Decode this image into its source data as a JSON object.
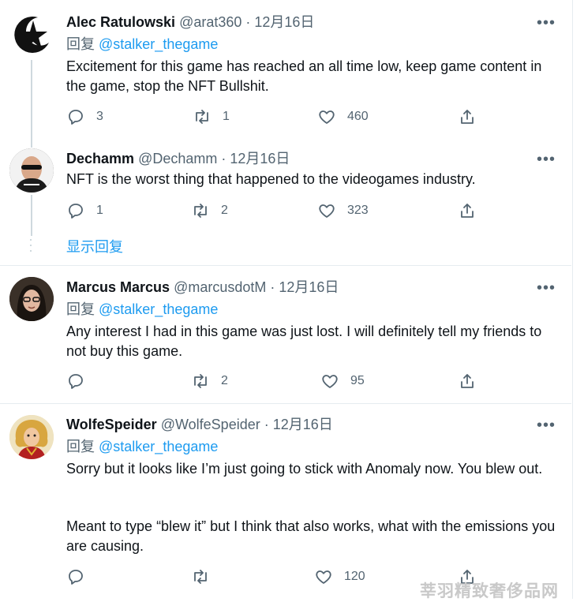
{
  "tweets": [
    {
      "name": "Alec Ratulowski",
      "handle": "@arat360",
      "sep": " · ",
      "date": "12月16日",
      "reply_prefix": "回复 ",
      "reply_to": "@stalker_thegame",
      "text": "Excitement for this game has reached an all time low, keep game content in the game, stop the NFT Bullshit.",
      "replies": "3",
      "retweets": "1",
      "likes": "460"
    },
    {
      "name": "Dechamm",
      "handle": "@Dechamm",
      "sep": " · ",
      "date": "12月16日",
      "text": "NFT is the worst thing that happened to the videogames industry.",
      "replies": "1",
      "retweets": "2",
      "likes": "323"
    },
    {
      "name": "Marcus Marcus",
      "handle": "@marcusdotM",
      "sep": " · ",
      "date": "12月16日",
      "reply_prefix": "回复 ",
      "reply_to": "@stalker_thegame",
      "text": "Any interest I had in this game was just lost. I will definitely tell my friends to not buy this game.",
      "replies": "",
      "retweets": "2",
      "likes": "95"
    },
    {
      "name": "WolfeSpeider",
      "handle": "@WolfeSpeider",
      "sep": " · ",
      "date": "12月16日",
      "reply_prefix": "回复 ",
      "reply_to": "@stalker_thegame",
      "text": "Sorry but it looks like I’m just going to stick with Anomaly now. You blew out.",
      "text2": "Meant to type “blew it” but I think that also works, what with the emissions you are causing.",
      "replies": "",
      "retweets": "",
      "likes": "120"
    }
  ],
  "show_replies": "显示回复",
  "more_label": "•••",
  "watermark": "莘羽精致奢侈品网",
  "colors": {
    "accent": "#1d9bf0",
    "secondary": "#536471",
    "text": "#0f1419",
    "border": "#e6ecf0"
  },
  "icons": [
    "reply-icon",
    "retweet-icon",
    "like-icon",
    "share-icon",
    "more-icon"
  ]
}
